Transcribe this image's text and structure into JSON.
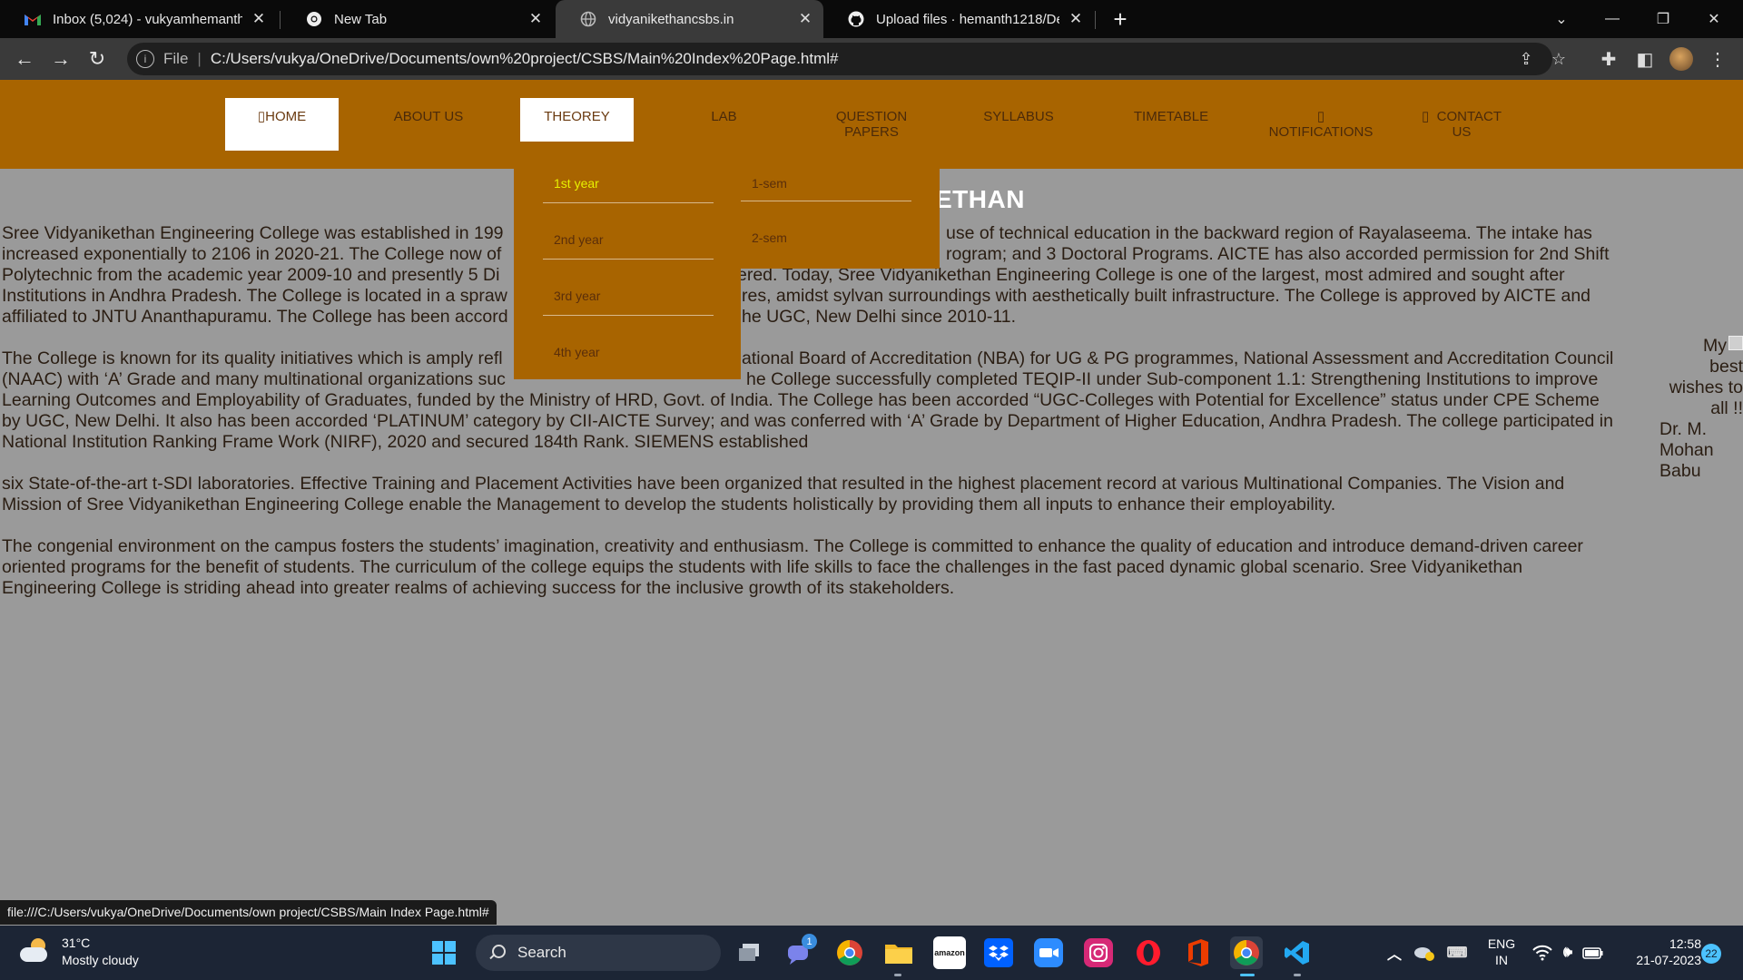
{
  "browser": {
    "tabs": [
      {
        "title": "Inbox (5,024) - vukyamhemanth1",
        "icon": "gmail-icon",
        "active": false
      },
      {
        "title": "New Tab",
        "icon": "chrome-icon",
        "active": false
      },
      {
        "title": "vidyanikethancsbs.in",
        "icon": "globe-icon",
        "active": true
      },
      {
        "title": "Upload files · hemanth1218/Depa",
        "icon": "github-icon",
        "active": false
      }
    ],
    "address": {
      "scheme": "File",
      "url": "C:/Users/vukya/OneDrive/Documents/own%20project/CSBS/Main%20Index%20Page.html#"
    },
    "status_url": "file:///C:/Users/vukya/OneDrive/Documents/own project/CSBS/Main Index Page.html#"
  },
  "nav": {
    "home": "HOME",
    "about": "ABOUT US",
    "theory": "THEOREY",
    "lab": "LAB",
    "question_papers": "QUESTION PAPERS",
    "syllabus": "SYLLABUS",
    "timetable": "TIMETABLE",
    "notifications": "NOTIFICATIONS",
    "contact": "CONTACT US",
    "icon_glyph": "▯"
  },
  "dropdown": {
    "years": [
      "1st year",
      "2nd year",
      "3rd year",
      "4th year"
    ],
    "sems": [
      "1-sem",
      "2-sem"
    ]
  },
  "content": {
    "heading": "ETHAN",
    "p1_lines": [
      "Sree Vidyanikethan Engineering College was established in 199",
      "increased exponentially to 2106 in 2020-21. The College now of",
      "Polytechnic from the academic year 2009-10 and presently 5 Di",
      "Institutions in Andhra Pradesh. The College is located in a spraw",
      "affiliated to JNTU Ananthapuramu. The College has been accord"
    ],
    "p1_lines_right": [
      "use of technical education in the backward region of Rayalaseema. The intake has",
      "rogram; and 3 Doctoral Programs. AICTE has also accorded permission for 2nd Shift",
      "ered. Today, Sree Vidyanikethan Engineering College is one of the largest, most admired and sought after",
      "res, amidst sylvan surroundings with aesthetically built infrastructure. The College is approved by AICTE and",
      "he UGC, New Delhi since 2010-11."
    ],
    "p2_line1_left": "The College is known for its quality initiatives which is amply refl",
    "p2_line1_right": "ational Board of Accreditation (NBA) for UG & PG programmes, National Assessment and Accreditation Council",
    "p2_line2_left": "(NAAC) with ‘A’ Grade and many multinational organizations suc",
    "p2_line2_right": "he College successfully completed TEQIP-II under Sub-component 1.1: Strengthening Institutions to improve",
    "p2_rest": [
      "Learning Outcomes and Employability of Graduates, funded by the Ministry of HRD, Govt. of India. The College has been accorded “UGC-Colleges with Potential for Excellence” status under CPE Scheme",
      "by UGC, New Delhi. It also has been accorded ‘PLATINUM’ category by CII-AICTE Survey; and was conferred with ‘A’ Grade by Department of Higher Education, Andhra Pradesh. The college participated in",
      "National Institution Ranking Frame Work (NIRF), 2020 and secured 184th Rank. SIEMENS established"
    ],
    "p3": [
      "six State-of-the-art t-SDI laboratories. Effective Training and Placement Activities have been organized that resulted in the highest placement record at various Multinational Companies. The Vision and",
      "Mission of Sree Vidyanikethan Engineering College enable the Management to develop the students holistically by providing them all inputs to enhance their employability."
    ],
    "p4": [
      "The congenial environment on the campus fosters the students’ imagination, creativity and enthusiasm. The College is committed to enhance the quality of education and introduce demand-driven career",
      "oriented programs for the benefit of students. The curriculum of the college equips the students with life skills to face the challenges in the fast paced dynamic global scenario. Sree Vidyanikethan",
      "Engineering College is striding ahead into greater realms of achieving success for the inclusive growth of its stakeholders."
    ],
    "wishes_lines": [
      "My",
      "best",
      "wishes to",
      "all !!"
    ],
    "author_lines": [
      "Dr. M.",
      "Mohan",
      "Babu"
    ]
  },
  "taskbar": {
    "weather_temp": "31°C",
    "weather_desc": "Mostly cloudy",
    "search_label": "Search",
    "lang_top": "ENG",
    "lang_bottom": "IN",
    "time": "12:58",
    "date": "21-07-2023",
    "notif_count": "22",
    "teams_badge": "1"
  }
}
